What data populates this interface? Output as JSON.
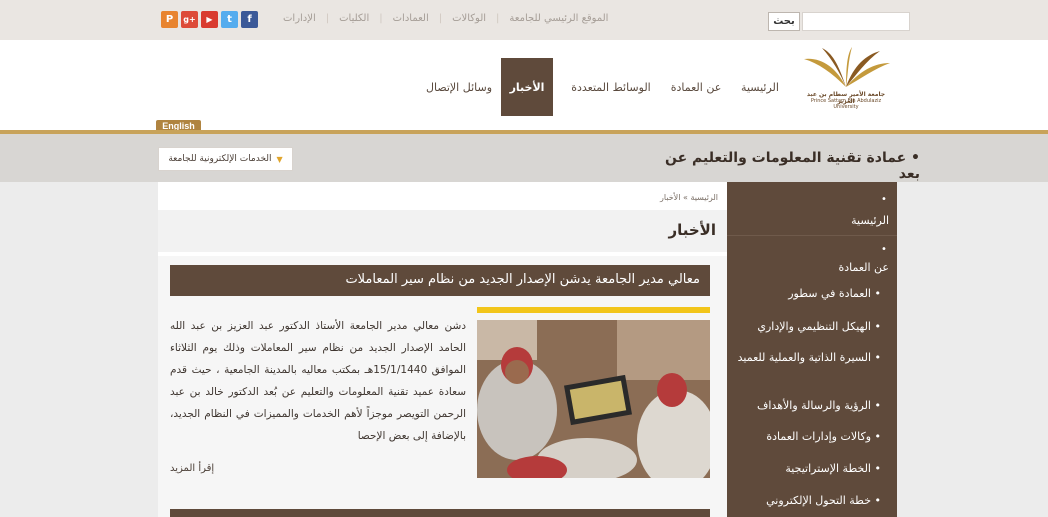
{
  "social": {
    "icons": [
      {
        "name": "facebook-icon",
        "glyph": "f",
        "color": "#3b5998"
      },
      {
        "name": "twitter-icon",
        "glyph": "t",
        "color": "#55acee"
      },
      {
        "name": "youtube-icon",
        "glyph": "▶",
        "color": "#d93b2f"
      },
      {
        "name": "googleplus-icon",
        "glyph": "g+",
        "color": "#dd4b39"
      },
      {
        "name": "flickr-icon",
        "glyph": "P",
        "color": "#e8842f"
      }
    ]
  },
  "toplinks": [
    "الموقع الرئيسي للجامعة",
    "الوكالات",
    "العمادات",
    "الكليات",
    "الإدارات"
  ],
  "search": {
    "button": "بحث",
    "placeholder": ""
  },
  "logo": {
    "arabic": "جامعة الأمير سطام بن عبد العزيز",
    "english": "Prince Sattam Bin Abdulaziz University"
  },
  "nav": {
    "home": "الرئيسية",
    "about": "عن العمادة",
    "media": "الوسائط المتعددة",
    "news": "الأخبار",
    "contact": "وسائل الإتصال"
  },
  "english_label": "English",
  "dept_title": "• عمادة تقنية المعلومات والتعليم عن بعد",
  "eservices": "الخدمات الإلكترونية للجامعة",
  "breadcrumb": "الرئيسية » الأخبار",
  "page_title": "الأخبار",
  "article": {
    "title": "معالي مدير الجامعة يدشن الإصدار الجديد من نظام سير المعاملات",
    "body": "دشن معالي مدير الجامعة الأستاذ الدكتور عبد العزيز بن عبد الله الحامد الإصدار الجديد من نظام سير المعاملات وذلك يوم الثلاثاء الموافق 15/1/1440هـ بمكتب معاليه بالمدينة الجامعية ، حيث قدم سعادة عميد تقنية المعلومات والتعليم عن بُعد الدكتور خالد بن عبد الرحمن التويصر موجزاً لأهم الخدمات والمميزات في النظام الجديد، بالإضافة إلى بعض الإحصا",
    "read_more": "إقرأ المزيد"
  },
  "sidebar": {
    "home": "الرئيسية",
    "about": "عن العمادة",
    "items": [
      "العمادة في سطور",
      "الهيكل التنظيمي والإداري",
      "السيرة الذاتية والعملية للعميد",
      "الرؤية والرسالة والأهداف",
      "وكالات وإدارات العمادة",
      "الخطة الإستراتيجية",
      "خطة التحول الإلكتروني"
    ]
  }
}
